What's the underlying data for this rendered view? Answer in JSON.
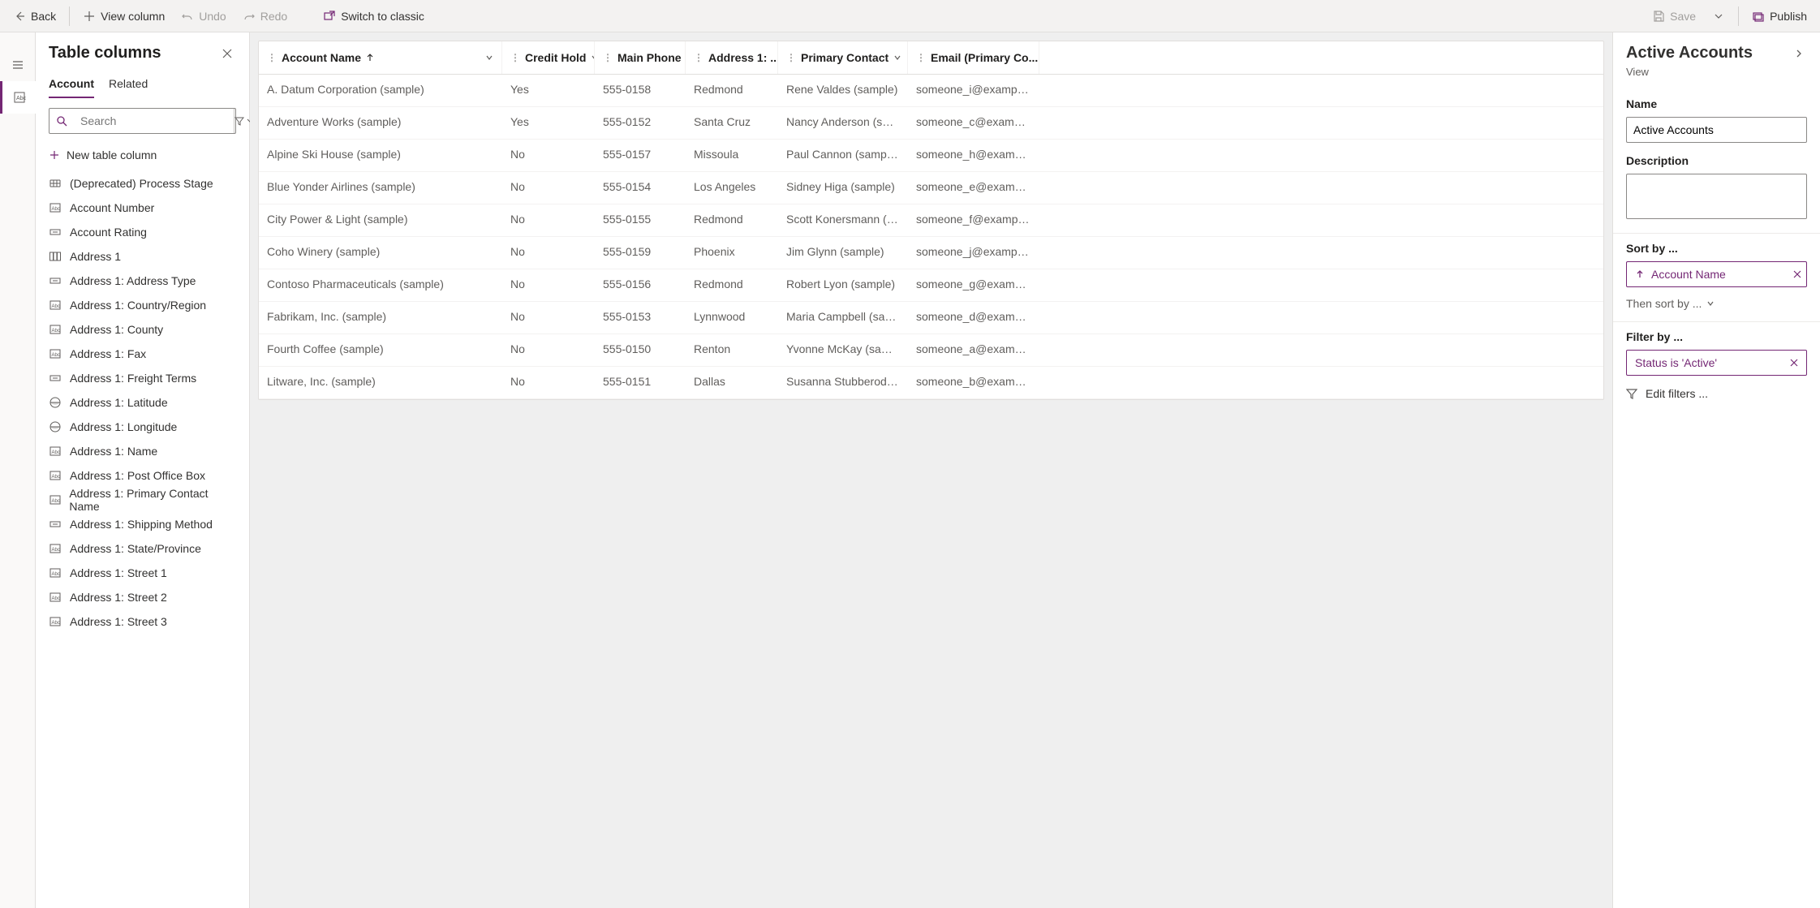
{
  "toolbar": {
    "back": "Back",
    "view_column": "View column",
    "undo": "Undo",
    "redo": "Redo",
    "switch": "Switch to classic",
    "save": "Save",
    "publish": "Publish"
  },
  "col_panel": {
    "title": "Table columns",
    "tab_account": "Account",
    "tab_related": "Related",
    "search_placeholder": "Search",
    "new_column": "New table column",
    "items": [
      {
        "type": "process",
        "label": "(Deprecated) Process Stage"
      },
      {
        "type": "abc",
        "label": "Account Number"
      },
      {
        "type": "option",
        "label": "Account Rating"
      },
      {
        "type": "group",
        "label": "Address 1"
      },
      {
        "type": "option",
        "label": "Address 1: Address Type"
      },
      {
        "type": "abc",
        "label": "Address 1: Country/Region"
      },
      {
        "type": "abc",
        "label": "Address 1: County"
      },
      {
        "type": "abc",
        "label": "Address 1: Fax"
      },
      {
        "type": "option",
        "label": "Address 1: Freight Terms"
      },
      {
        "type": "geo",
        "label": "Address 1: Latitude"
      },
      {
        "type": "geo",
        "label": "Address 1: Longitude"
      },
      {
        "type": "abc",
        "label": "Address 1: Name"
      },
      {
        "type": "abc",
        "label": "Address 1: Post Office Box"
      },
      {
        "type": "abc",
        "label": "Address 1: Primary Contact Name"
      },
      {
        "type": "option",
        "label": "Address 1: Shipping Method"
      },
      {
        "type": "abc",
        "label": "Address 1: State/Province"
      },
      {
        "type": "abc",
        "label": "Address 1: Street 1"
      },
      {
        "type": "abc",
        "label": "Address 1: Street 2"
      },
      {
        "type": "abc",
        "label": "Address 1: Street 3"
      }
    ]
  },
  "grid": {
    "columns": [
      "Account Name",
      "Credit Hold",
      "Main Phone",
      "Address 1: ...",
      "Primary Contact",
      "Email (Primary Co..."
    ],
    "rows": [
      {
        "name": "A. Datum Corporation (sample)",
        "hold": "Yes",
        "phone": "555-0158",
        "city": "Redmond",
        "contact": "Rene Valdes (sample)",
        "email": "someone_i@example.com"
      },
      {
        "name": "Adventure Works (sample)",
        "hold": "Yes",
        "phone": "555-0152",
        "city": "Santa Cruz",
        "contact": "Nancy Anderson (sample)",
        "email": "someone_c@example.com"
      },
      {
        "name": "Alpine Ski House (sample)",
        "hold": "No",
        "phone": "555-0157",
        "city": "Missoula",
        "contact": "Paul Cannon (sample)",
        "email": "someone_h@example.com"
      },
      {
        "name": "Blue Yonder Airlines (sample)",
        "hold": "No",
        "phone": "555-0154",
        "city": "Los Angeles",
        "contact": "Sidney Higa (sample)",
        "email": "someone_e@example.com"
      },
      {
        "name": "City Power & Light (sample)",
        "hold": "No",
        "phone": "555-0155",
        "city": "Redmond",
        "contact": "Scott Konersmann (sample)",
        "email": "someone_f@example.com"
      },
      {
        "name": "Coho Winery (sample)",
        "hold": "No",
        "phone": "555-0159",
        "city": "Phoenix",
        "contact": "Jim Glynn (sample)",
        "email": "someone_j@example.com"
      },
      {
        "name": "Contoso Pharmaceuticals (sample)",
        "hold": "No",
        "phone": "555-0156",
        "city": "Redmond",
        "contact": "Robert Lyon (sample)",
        "email": "someone_g@example.com"
      },
      {
        "name": "Fabrikam, Inc. (sample)",
        "hold": "No",
        "phone": "555-0153",
        "city": "Lynnwood",
        "contact": "Maria Campbell (sample)",
        "email": "someone_d@example.com"
      },
      {
        "name": "Fourth Coffee (sample)",
        "hold": "No",
        "phone": "555-0150",
        "city": "Renton",
        "contact": "Yvonne McKay (sample)",
        "email": "someone_a@example.com"
      },
      {
        "name": "Litware, Inc. (sample)",
        "hold": "No",
        "phone": "555-0151",
        "city": "Dallas",
        "contact": "Susanna Stubberod (sampl...",
        "email": "someone_b@example.com"
      }
    ]
  },
  "right": {
    "title": "Active Accounts",
    "subtitle": "View",
    "name_label": "Name",
    "name_value": "Active Accounts",
    "desc_label": "Description",
    "desc_value": "",
    "sort_label": "Sort by ...",
    "sort_chip": "Account Name",
    "then_sort": "Then sort by ...",
    "filter_label": "Filter by ...",
    "filter_chip": "Status is 'Active'",
    "edit_filters": "Edit filters ..."
  }
}
